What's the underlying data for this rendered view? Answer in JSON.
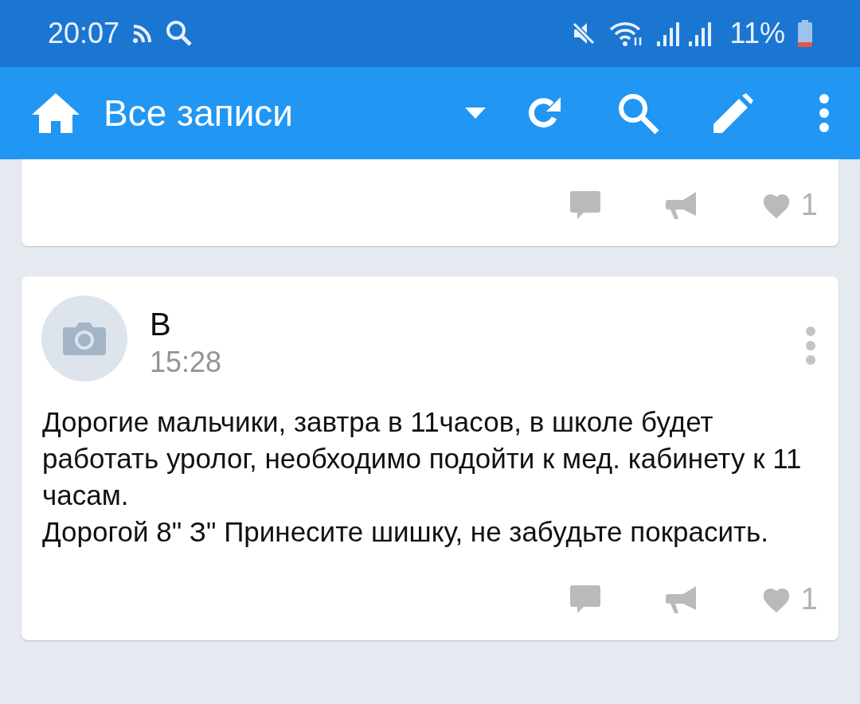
{
  "status_bar": {
    "time": "20:07",
    "battery": "11%"
  },
  "app_bar": {
    "title": "Все записи"
  },
  "posts": [
    {
      "kind": "partial",
      "likes": "1"
    },
    {
      "kind": "full",
      "author": "В",
      "time": "15:28",
      "text": "Дорогие мальчики, завтра в 11часов, в школе будет работать уролог, необходимо подойти к мед. кабинету к 11 часам.\nДорогой 8\" З\" Принесите шишку, не забудьте покрасить.",
      "likes": "1"
    }
  ]
}
